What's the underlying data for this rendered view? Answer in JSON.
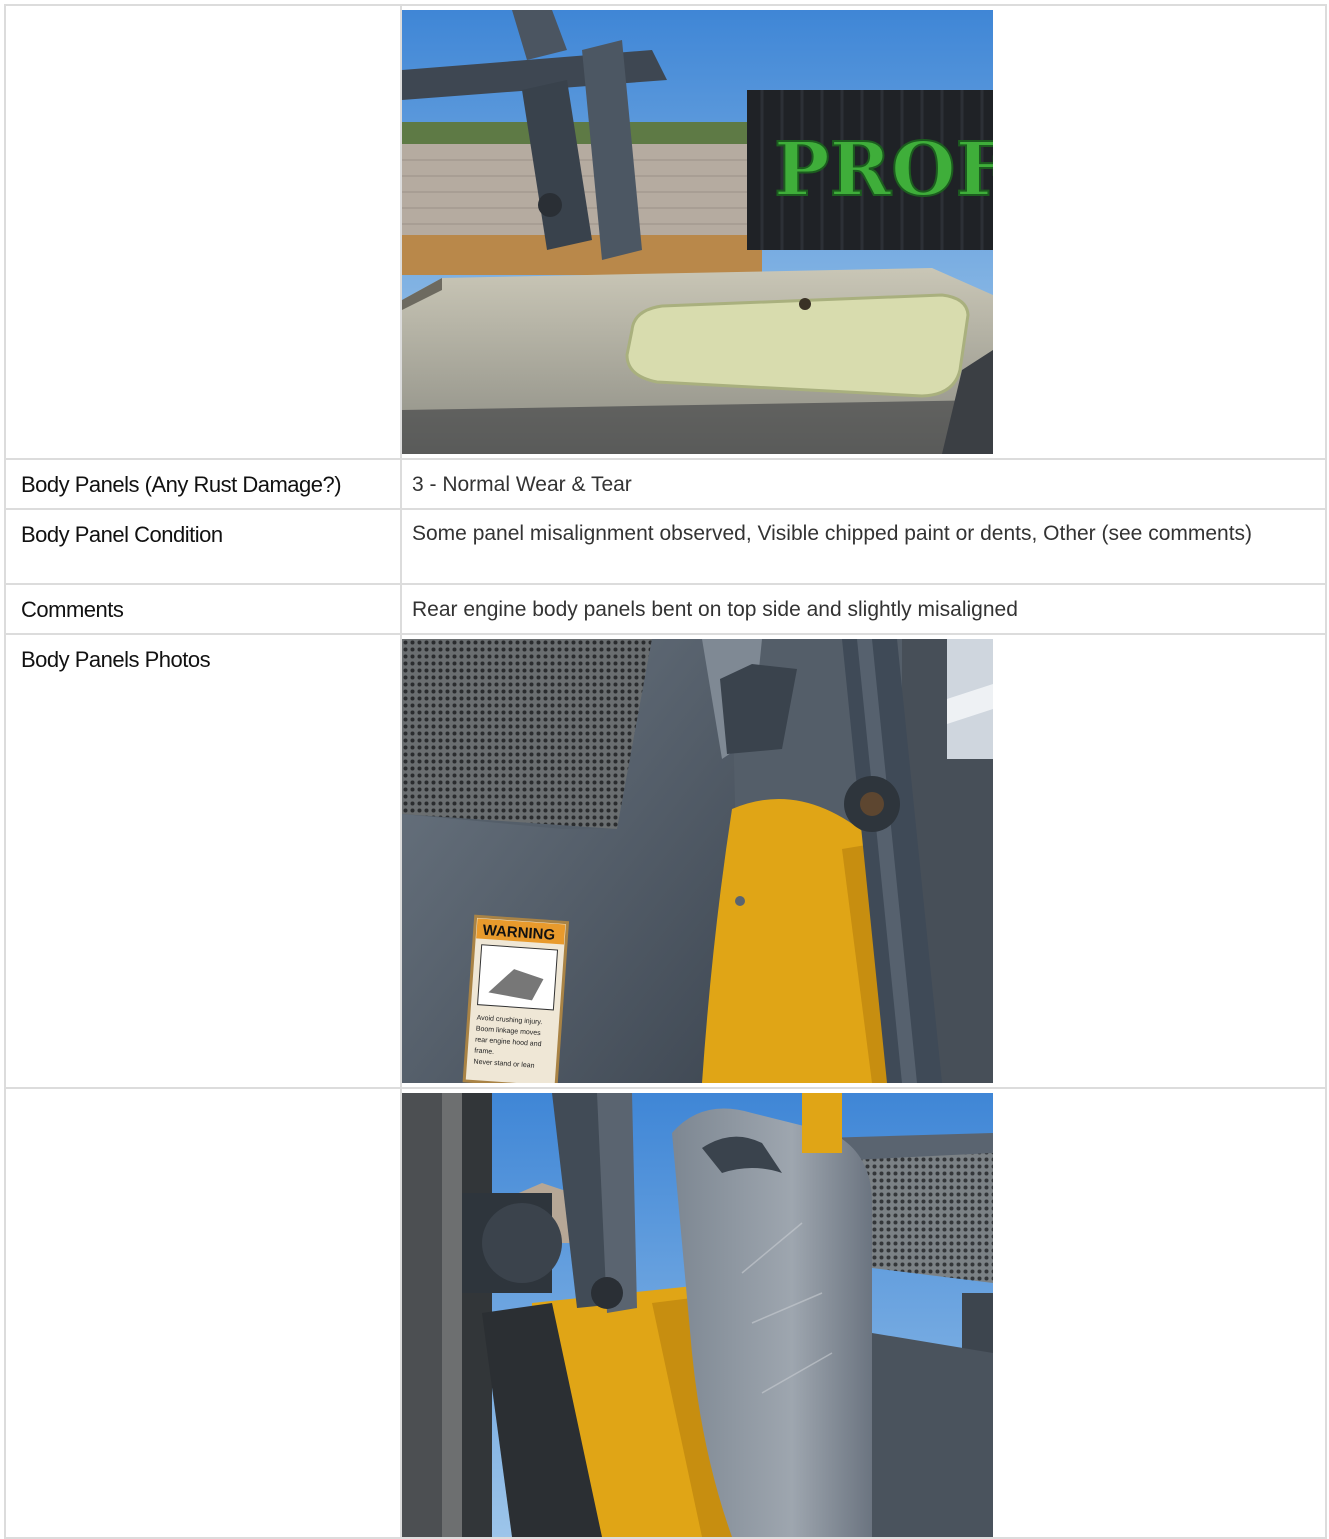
{
  "rows": {
    "rust": {
      "label": "Body Panels (Any Rust Damage?)",
      "value": "3 - Normal Wear & Tear"
    },
    "condition": {
      "label": "Body Panel Condition",
      "value": "Some panel misalignment observed, Visible chipped paint or dents, Other (see comments)"
    },
    "comments": {
      "label": "Comments",
      "value": "Rear engine body panels bent on top side and slightly misaligned"
    },
    "photos": {
      "label": "Body Panels Photos"
    }
  },
  "photos": {
    "top": {
      "graffiti_text": "PROFOK"
    },
    "second": {
      "warning_label": "WARNING",
      "warning_fine_print": "Avoid crushing injury. Boom linkage moves rear engine hood and frame. Never stand or lean anywhere on loader."
    }
  },
  "colors": {
    "border": "#dcdcdc",
    "label_text": "#111111",
    "value_text": "#333333",
    "machine_gray": "#5a6470",
    "machine_yellow": "#e0a516"
  }
}
